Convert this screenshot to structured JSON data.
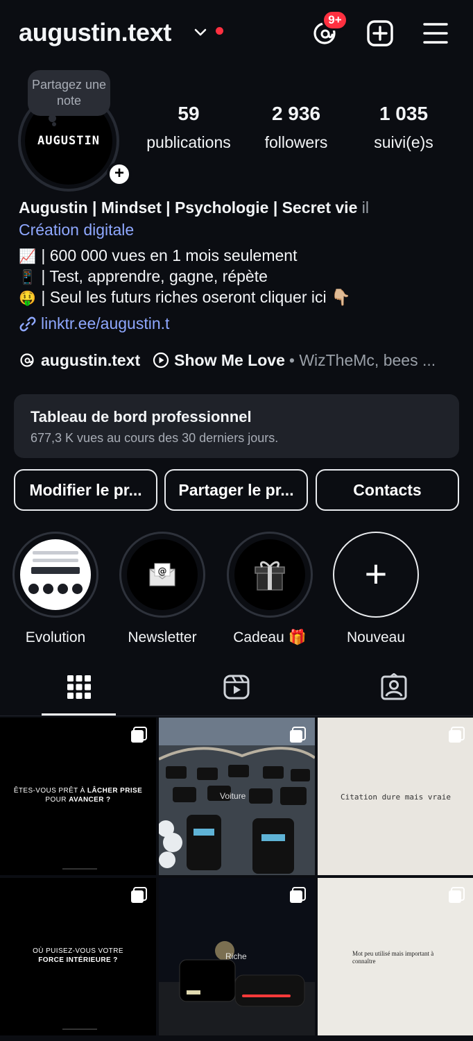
{
  "header": {
    "username": "augustin.text",
    "threads_badge": "9+"
  },
  "note": {
    "text": "Partagez une note"
  },
  "avatar": {
    "text": "AUGUSTIN"
  },
  "stats": [
    {
      "value": "59",
      "label": "publications"
    },
    {
      "value": "2 936",
      "label": "followers"
    },
    {
      "value": "1 035",
      "label": "suivi(e)s"
    }
  ],
  "bio": {
    "name": "Augustin | Mindset | Psychologie | Secret vie",
    "name_tail": "il",
    "category": "Création digitale",
    "lines": [
      {
        "emoji": "📈",
        "text": "| 600 000 vues en 1 mois seulement"
      },
      {
        "emoji": "📱",
        "text": "| Test, apprendre, gagne, répète"
      },
      {
        "emoji": "🤑",
        "text": "| Seul les futurs riches oseront cliquer ici 👇🏼"
      }
    ],
    "link": "linktr.ee/augustin.t"
  },
  "threads_row": {
    "handle": "augustin.text",
    "song": "Show Me Love",
    "artists": "• WizTheMc, bees ..."
  },
  "dashboard": {
    "title": "Tableau de bord professionnel",
    "subtitle": "677,3 K vues au cours des 30 derniers jours."
  },
  "buttons": {
    "edit": "Modifier le pr...",
    "share": "Partager le pr...",
    "contacts": "Contacts"
  },
  "highlights": [
    {
      "label": "Evolution"
    },
    {
      "label": "Newsletter",
      "icon": "📧"
    },
    {
      "label": "Cadeau 🎁",
      "icon": "🎁"
    },
    {
      "label": "Nouveau"
    }
  ],
  "posts": [
    {
      "line1": "ÊTES-VOUS PRÊT À",
      "bold1": "LÂCHER PRISE",
      "line2": "POUR",
      "bold2": "AVANCER ?"
    },
    {
      "overlay": "Voiture"
    },
    {
      "text": "Citation dure mais vraie"
    },
    {
      "line1": "OÙ PUISEZ-VOUS VOTRE",
      "bold2": "FORCE INTÉRIEURE ?"
    },
    {
      "overlay": "Riche"
    },
    {
      "text": "Mot peu utilisé mais important à connaître"
    }
  ],
  "colors": {
    "background": "#0b0d12",
    "link": "#8fa8ff",
    "badge": "#ff3040",
    "card": "#1f2229"
  }
}
